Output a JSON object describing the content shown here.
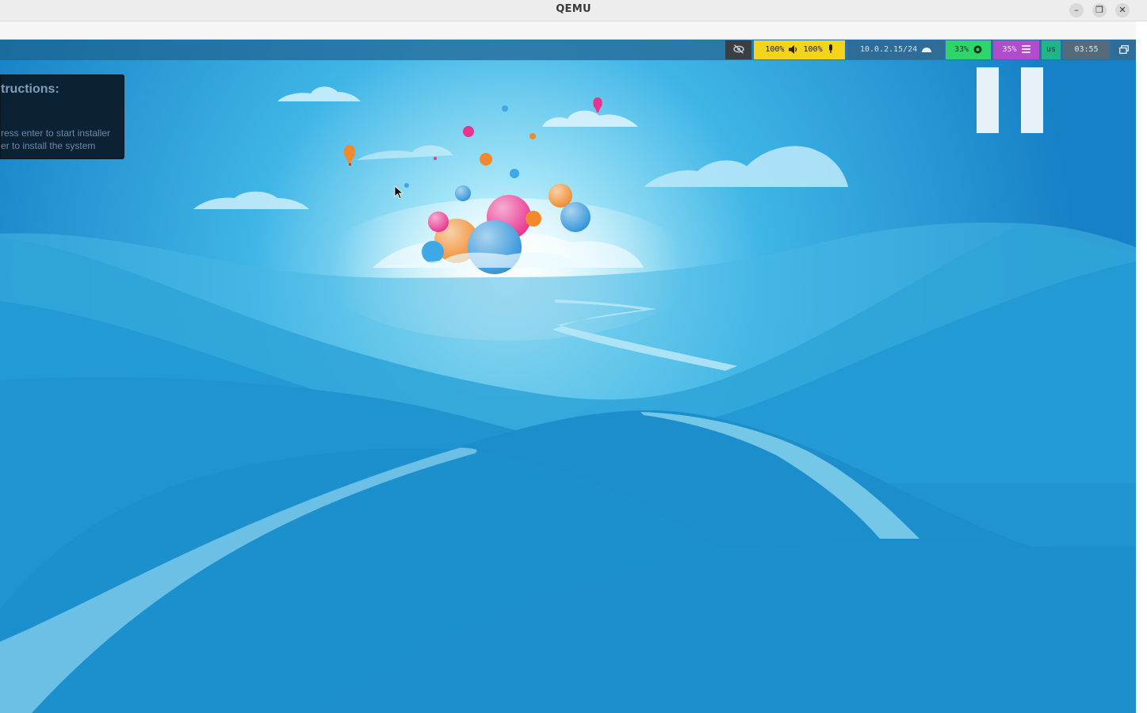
{
  "window": {
    "title": "QEMU",
    "controls": {
      "minimize": "–",
      "restore": "❐",
      "close": "✕"
    }
  },
  "panel": {
    "status_icons": [
      "eye-slash-icon",
      "speaker-icon",
      "microphone-icon",
      "network-icon",
      "cpu-icon",
      "memory-icon",
      "window-icon"
    ],
    "volume": "100%",
    "mic": "100%",
    "ip": "10.0.2.15/24",
    "cpu": "33%",
    "memory": "35%",
    "keyboard_layout": "us",
    "clock": "03:55",
    "colors": {
      "privacy": "#3a3f44",
      "audio": "#f2d41a",
      "network": "#2f6d98",
      "cpu": "#2fd56a",
      "memory": "#b14ccd",
      "keyboard": "#21b38a",
      "clock": "#556a7a",
      "window": "#2f6d98"
    }
  },
  "instructions": {
    "heading": "tructions:",
    "line1": "ress enter to start installer",
    "line2": "er to install the system"
  },
  "overlay": {
    "icon": "pause-icon"
  }
}
